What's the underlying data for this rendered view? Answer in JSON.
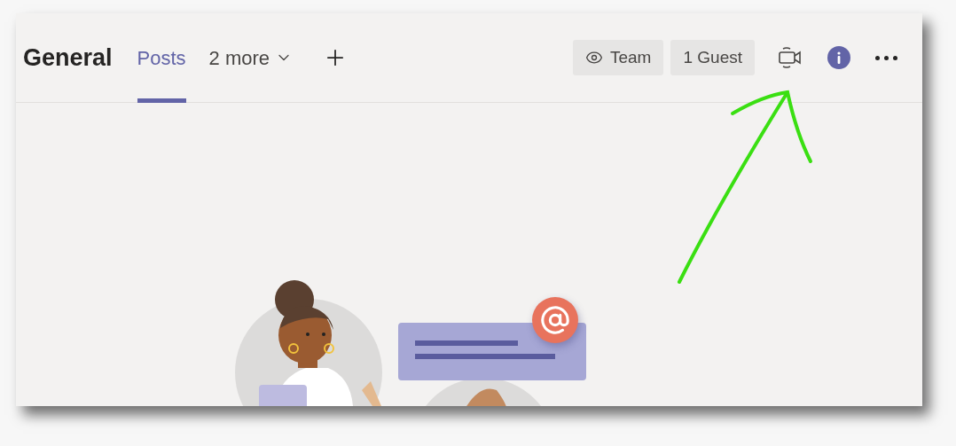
{
  "channel": {
    "title": "General"
  },
  "tabs": [
    {
      "label": "Posts",
      "selected": true,
      "kind": "tab"
    },
    {
      "label": "2 more",
      "selected": false,
      "kind": "dropdown"
    }
  ],
  "badges": [
    {
      "label": "Team",
      "kind": "eye"
    },
    {
      "label": "1 Guest",
      "kind": "plain"
    }
  ]
}
